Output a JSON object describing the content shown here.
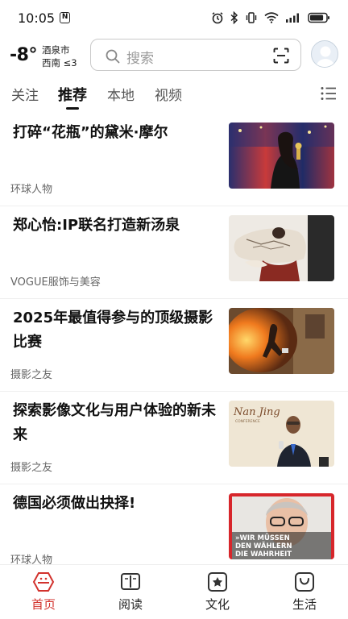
{
  "status": {
    "time": "10:05",
    "notif_badge": "N",
    "battery_level": 0.85
  },
  "weather": {
    "temperature": "-8°",
    "city": "酒泉市",
    "wind": "西南 ≤3"
  },
  "search": {
    "placeholder": "搜索"
  },
  "tabs": [
    {
      "label": "关注",
      "active": false
    },
    {
      "label": "推荐",
      "active": true
    },
    {
      "label": "本地",
      "active": false
    },
    {
      "label": "视频",
      "active": false
    }
  ],
  "feed": [
    {
      "title": "打碎“花瓶”的黛米·摩尔",
      "source": "环球人物",
      "thumb": "woman-with-award-photo"
    },
    {
      "title": "郑心怡:IP联名打造新汤泉",
      "source": "VOGUE服饰与美容",
      "thumb": "fashion-model-photo"
    },
    {
      "title": "2025年最值得参与的顶级摄影比赛",
      "source": "摄影之友",
      "thumb": "fire-street-photo"
    },
    {
      "title": "探索影像文化与用户体验的新未来",
      "source": "摄影之友",
      "thumb": "speaker-at-podium-photo"
    },
    {
      "title": "德国必须做出抉择!",
      "source": "环球人物",
      "thumb": "magazine-cover-photo"
    }
  ],
  "thumb_text": {
    "nanjing_1": "Nan Jing",
    "nanjing_2": "CONFERENCE",
    "cover_1": "»WIR MÜSSEN",
    "cover_2": "DEN WÄHLERN",
    "cover_3": "DIE WAHRHEIT"
  },
  "bottom_nav": [
    {
      "label": "首页",
      "icon": "home-hex-icon",
      "active": true
    },
    {
      "label": "阅读",
      "icon": "book-icon",
      "active": false
    },
    {
      "label": "文化",
      "icon": "star-frame-icon",
      "active": false
    },
    {
      "label": "生活",
      "icon": "bag-smile-icon",
      "active": false
    }
  ],
  "colors": {
    "accent": "#d2322d",
    "text": "#111111",
    "muted": "#666666"
  }
}
